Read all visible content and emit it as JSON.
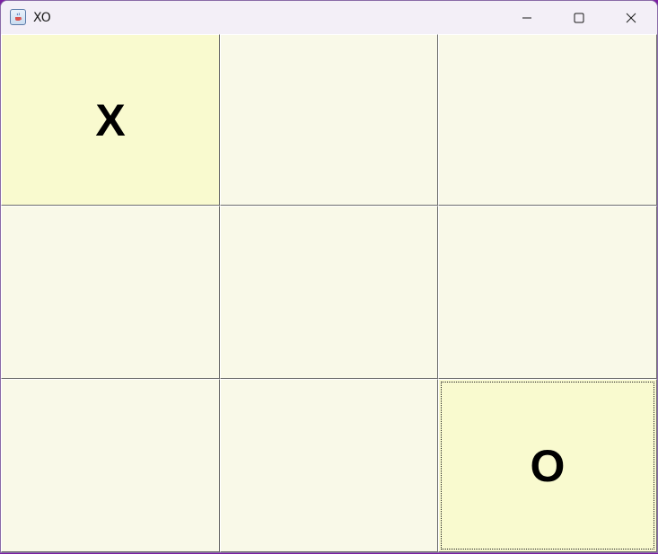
{
  "window": {
    "title": "XO",
    "app_icon": "java-cup-icon",
    "controls": [
      "minimize-icon",
      "maximize-icon",
      "close-icon"
    ]
  },
  "board": {
    "cells": [
      {
        "mark": "X",
        "highlighted": true
      },
      {
        "mark": "",
        "highlighted": false
      },
      {
        "mark": "",
        "highlighted": false
      },
      {
        "mark": "",
        "highlighted": false
      },
      {
        "mark": "",
        "highlighted": false
      },
      {
        "mark": "",
        "highlighted": false
      },
      {
        "mark": "",
        "highlighted": false
      },
      {
        "mark": "",
        "highlighted": false
      },
      {
        "mark": "O",
        "highlighted": true,
        "focused": true
      }
    ]
  },
  "colors": {
    "cell_background": "#f9f9e8",
    "played_cell_background": "#f9facf",
    "mark": "#000000",
    "titlebar": "#f3eff7"
  }
}
